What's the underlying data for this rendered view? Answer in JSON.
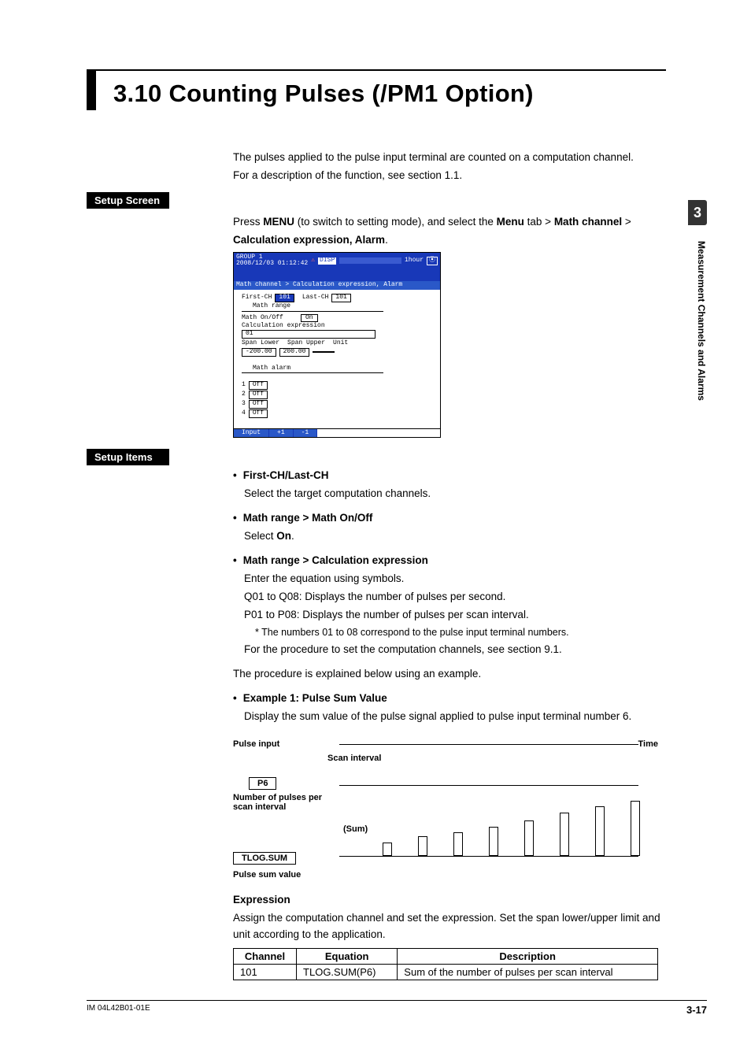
{
  "side": {
    "chapter_num": "3",
    "chapter_label": "Measurement Channels and Alarms"
  },
  "title": "3.10  Counting Pulses (/PM1 Option)",
  "intro1": "The pulses applied to the pulse input terminal are counted on a computation channel.",
  "intro2": "For a description of the function, see section 1.1.",
  "setup_screen_label": "Setup Screen",
  "setup_items_label": "Setup Items",
  "setup_screen": {
    "line_prefix": "Press ",
    "menu1": "MENU",
    "line_mid": " (to switch to setting mode), and select the ",
    "menu2": "Menu",
    "gt1": " tab > ",
    "menu3": "Math channel",
    "gt2": " > ",
    "line2": "Calculation expression, Alarm",
    "period": "."
  },
  "shot": {
    "group": "GROUP 1",
    "datetime": "2008/12/03 01:12:42",
    "disp": "DISP",
    "hour": "1hour",
    "breadcrumb": "Math channel > Calculation expression, Alarm",
    "first_ch": "First-CH",
    "first_val": "101",
    "last_ch": "Last-CH",
    "last_val": "101",
    "math_range": "Math range",
    "math_onoff": "Math On/Off",
    "on": "On",
    "calc_expr": "Calculation expression",
    "expr_val": "01",
    "span_lower": "Span Lower",
    "span_lower_v": "-200.00",
    "span_upper": "Span Upper",
    "span_upper_v": "200.00",
    "unit": "Unit",
    "math_alarm": "Math alarm",
    "alarm1_n": "1",
    "alarm1_v": "Off",
    "alarm2_n": "2",
    "alarm2_v": "Off",
    "alarm3_n": "3",
    "alarm3_v": "Off",
    "alarm4_n": "4",
    "alarm4_v": "Off",
    "foot_input": "Input",
    "foot_p1": "+1",
    "foot_m1": "-1"
  },
  "items": {
    "h1": "First-CH/Last-CH",
    "p1": "Select the target computation channels.",
    "h2": "Math range > Math On/Off",
    "p2a": "Select ",
    "p2b": "On",
    "p2c": ".",
    "h3": "Math range > Calculation expression",
    "p3": "Enter the equation using symbols.",
    "p3a": "Q01 to Q08:   Displays the number of pulses per second.",
    "p3b": "P01 to P08:   Displays the number of pulses per scan interval.",
    "p3note": "*   The numbers 01 to 08 correspond to the pulse input terminal numbers.",
    "p3c": "For the procedure to set the computation channels, see section 9.1.",
    "explain": "The procedure is explained below using an example.",
    "h4": "Example 1: Pulse Sum Value",
    "p4": "Display the sum value of the pulse signal applied to pulse input terminal number 6."
  },
  "diagram": {
    "pulse_input": "Pulse input",
    "time": "Time",
    "scan_interval": "Scan interval",
    "p6": "P6",
    "num_pulses": "Number of pulses per scan interval",
    "sum": "(Sum)",
    "tlog": "TLOG.SUM",
    "pulse_sum": "Pulse sum value"
  },
  "expr": {
    "head": "Expression",
    "text": "Assign the computation channel and set the expression. Set the span lower/upper limit and unit according to the application.",
    "th1": "Channel",
    "th2": "Equation",
    "th3": "Description",
    "td1": "101",
    "td2": "TLOG.SUM(P6)",
    "td3": "Sum of the number of pulses per scan interval"
  },
  "footer": {
    "code": "IM 04L42B01-01E",
    "page": "3-17"
  }
}
